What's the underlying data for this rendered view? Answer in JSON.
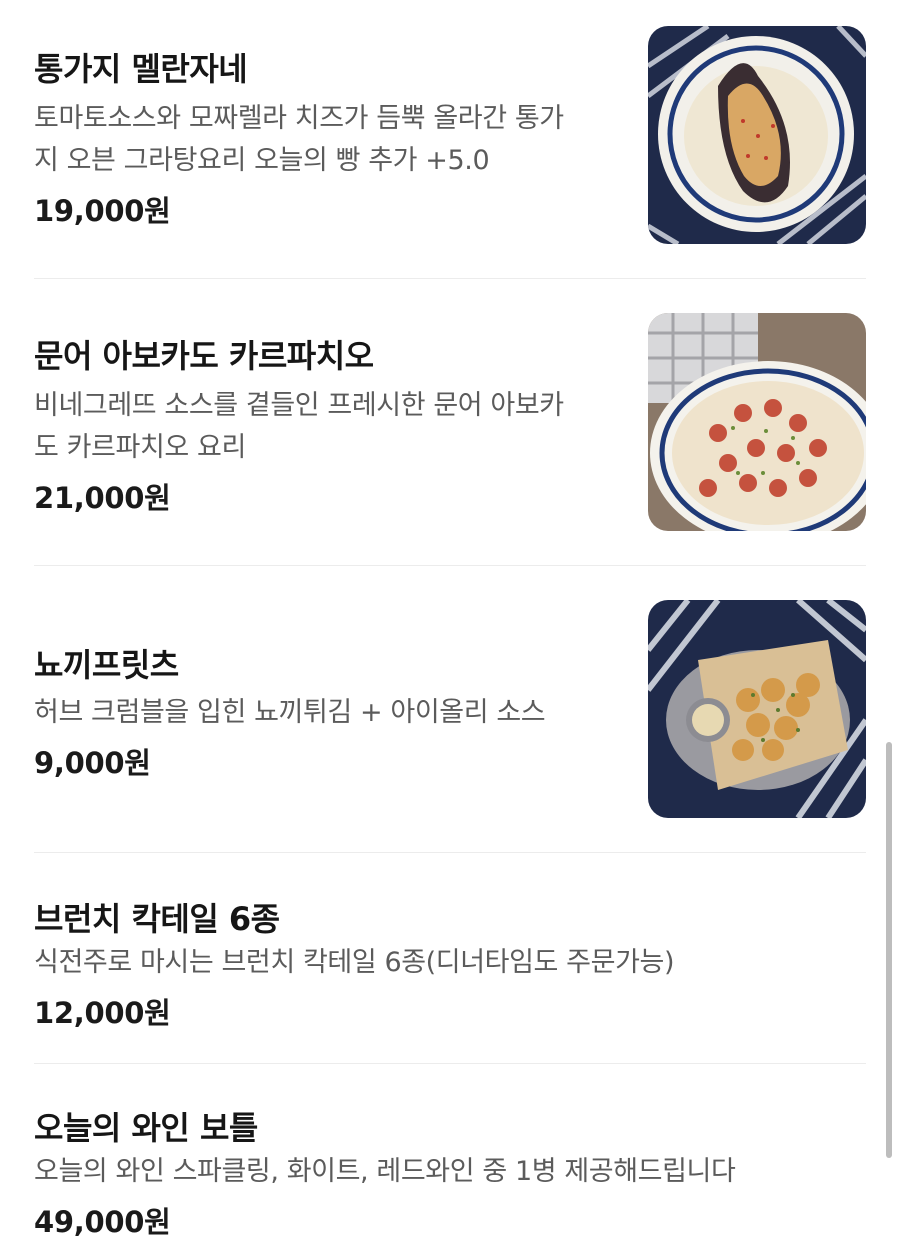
{
  "menu": {
    "items": [
      {
        "name": "통가지 멜란자네",
        "desc_lines": [
          "토마토소스와 모짜렐라 치즈가 듬뿍 올라간 통가",
          "지 오븐 그라탕요리 오늘의 빵 추가 +5.0"
        ],
        "price": "19,000원",
        "image": "eggplant-gratin-photo"
      },
      {
        "name": "문어 아보카도 카르파치오",
        "desc_lines": [
          "비네그레뜨 소스를 곁들인 프레시한 문어 아보카",
          "도 카르파치오 요리"
        ],
        "price": "21,000원",
        "image": "octopus-carpaccio-photo"
      },
      {
        "name": "뇨끼프릿츠",
        "desc_lines": [
          "허브 크럼블을 입힌 뇨끼튀김 + 아이올리 소스"
        ],
        "price": "9,000원",
        "image": "gnocchi-fritto-photo"
      },
      {
        "name": "브런치 칵테일 6종",
        "desc_lines": [
          "식전주로 마시는 브런치 칵테일 6종(디너타임도 주문가능)"
        ],
        "price": "12,000원"
      },
      {
        "name": "오늘의 와인 보틀",
        "desc_lines": [
          "오늘의 와인 스파클링, 화이트, 레드와인 중 1병 제공해드립니다"
        ],
        "price": "49,000원"
      }
    ]
  },
  "colors": {
    "text": "#161616",
    "subtext": "#5b5b5b",
    "divider": "#ececec",
    "tablecloth": "#1f2a4a"
  }
}
